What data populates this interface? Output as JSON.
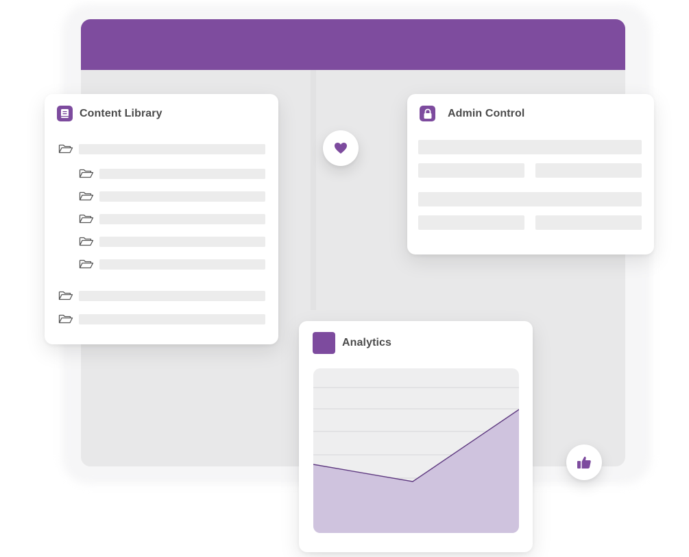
{
  "colors": {
    "accent": "#7d4b9e",
    "header_bar": "#7e4c9e",
    "chart_fill": "#cfc3de",
    "chart_line": "#5f3a80",
    "placeholder_bar": "#ececec",
    "window_body": "#e8e8e9"
  },
  "content_library": {
    "title": "Content Library",
    "icon": "book-icon",
    "folder_icon": "folder-open-icon"
  },
  "admin_control": {
    "title": "Admin Control",
    "icon": "lock-icon"
  },
  "analytics": {
    "title": "Analytics",
    "icon": "square-icon"
  },
  "bubbles": {
    "heart_icon": "heart-icon",
    "thumb_icon": "thumbs-up-icon"
  }
}
